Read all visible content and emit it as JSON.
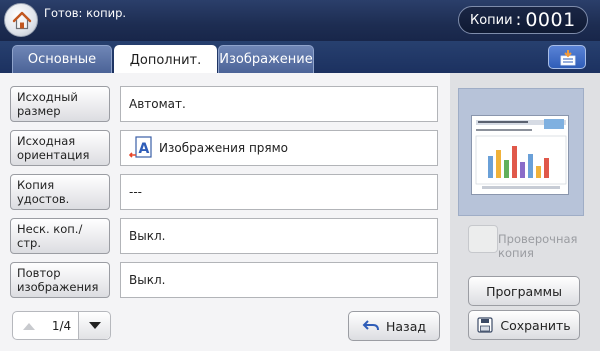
{
  "header": {
    "status": "Готов: копир.",
    "copies_label": "Копии",
    "copies_colon": ":",
    "copies_value": "0001"
  },
  "tabs": [
    {
      "label": "Основные"
    },
    {
      "label": "Дополнит."
    },
    {
      "label": "Изображение"
    }
  ],
  "rows": [
    {
      "button": "Исходный размер",
      "value": "Автомат."
    },
    {
      "button": "Исходная ориентация",
      "value": "Изображения прямо",
      "icon": "orientation-portrait-icon"
    },
    {
      "button": "Копия удостов.",
      "value": "---"
    },
    {
      "button": "Неск. коп./стр.",
      "value": "Выкл."
    },
    {
      "button": "Повтор изображения",
      "value": "Выкл."
    }
  ],
  "pager": {
    "page": "1/4"
  },
  "actions": {
    "back": "Назад",
    "programs": "Программы",
    "save": "Сохранить",
    "proof_copy": "Проверочная копия"
  },
  "icons": [
    "home-icon",
    "panel-settings-icon",
    "orientation-portrait-icon",
    "arrow-up-icon",
    "arrow-down-icon",
    "undo-icon",
    "floppy-disk-icon"
  ],
  "colors": {
    "header": "#1d2d52",
    "accent": "#2f5db8"
  }
}
